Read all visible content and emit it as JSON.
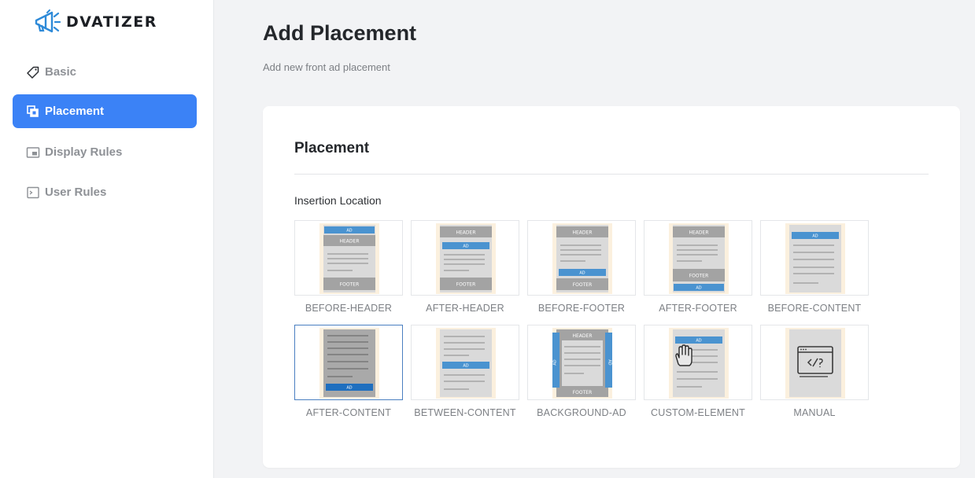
{
  "brand": {
    "name": "DVATIZER",
    "accent": "#3b82f6"
  },
  "sidebar": {
    "items": [
      {
        "label": "Basic",
        "icon": "tag-icon",
        "active": false
      },
      {
        "label": "Placement",
        "icon": "copy-icon",
        "active": true
      },
      {
        "label": "Display Rules",
        "icon": "picture-in-picture-icon",
        "active": false
      },
      {
        "label": "User Rules",
        "icon": "terminal-icon",
        "active": false
      }
    ]
  },
  "main": {
    "title": "Add Placement",
    "subtitle": "Add new front ad placement",
    "card": {
      "title": "Placement",
      "field_label": "Insertion Location",
      "options": [
        {
          "label": "BEFORE-HEADER",
          "selected": false
        },
        {
          "label": "AFTER-HEADER",
          "selected": false
        },
        {
          "label": "BEFORE-FOOTER",
          "selected": false
        },
        {
          "label": "AFTER-FOOTER",
          "selected": false
        },
        {
          "label": "BEFORE-CONTENT",
          "selected": false
        },
        {
          "label": "AFTER-CONTENT",
          "selected": true
        },
        {
          "label": "BETWEEN-CONTENT",
          "selected": false
        },
        {
          "label": "BACKGROUND-AD",
          "selected": false
        },
        {
          "label": "CUSTOM-ELEMENT",
          "selected": false
        },
        {
          "label": "MANUAL",
          "selected": false
        }
      ],
      "thumb_text": {
        "ad": "AD",
        "header": "HEADER",
        "footer": "FOOTER"
      }
    }
  }
}
